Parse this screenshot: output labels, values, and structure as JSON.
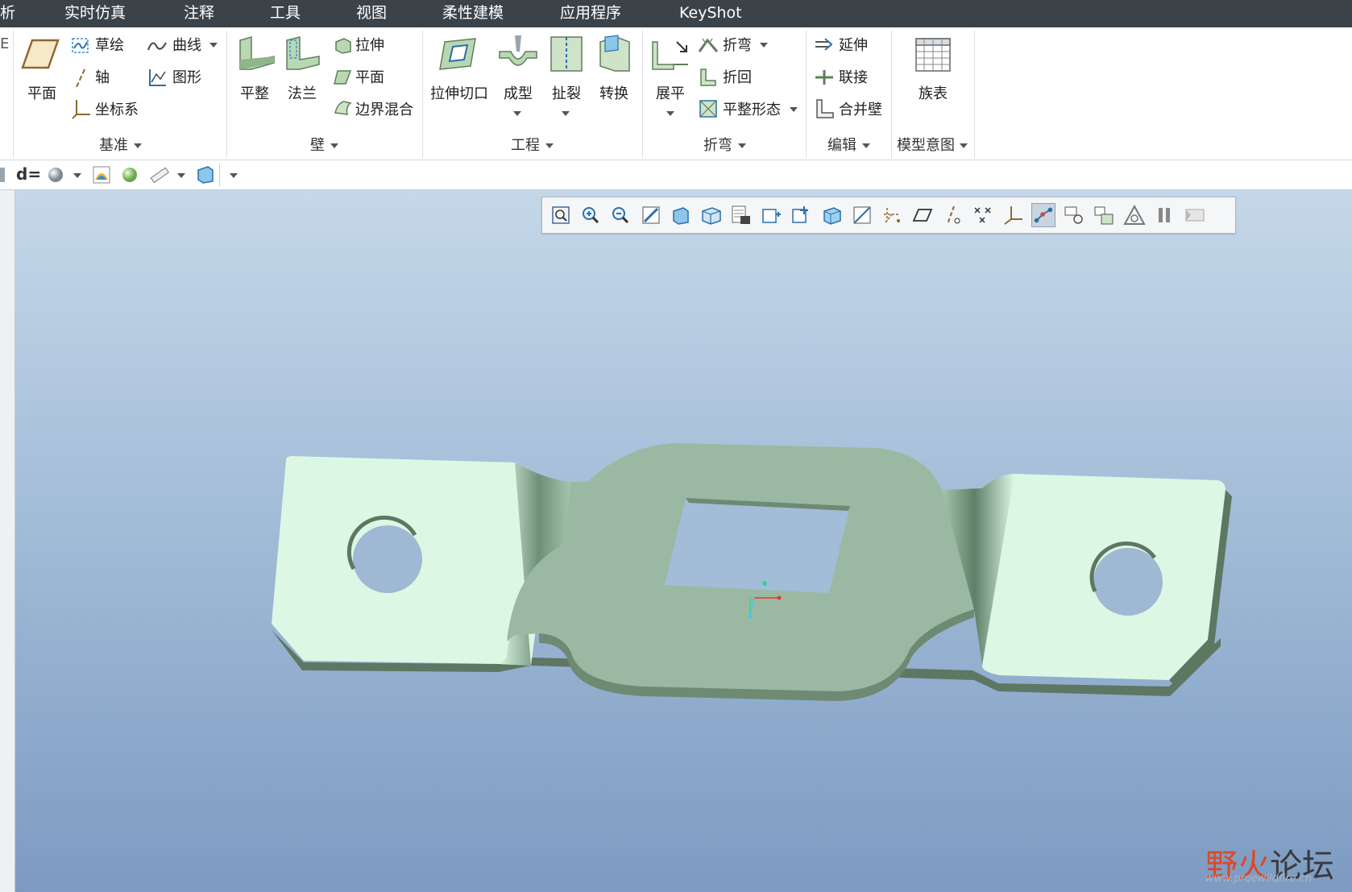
{
  "menu": {
    "partial_left": "析",
    "items": [
      "实时仿真",
      "注释",
      "工具",
      "视图",
      "柔性建模",
      "应用程序",
      "KeyShot"
    ]
  },
  "ribbon": {
    "partial_left": "E",
    "datum": {
      "plane": "平面",
      "sketch": "草绘",
      "curve": "曲线",
      "axis": "轴",
      "graph": "图形",
      "csys": "坐标系",
      "group": "基准"
    },
    "wall": {
      "flat": "平整",
      "flange": "法兰",
      "extrude": "拉伸",
      "planar": "平面",
      "boundary_blend": "边界混合",
      "group": "壁"
    },
    "engineering": {
      "extrude_cut": "拉伸切口",
      "form": "成型",
      "rip": "扯裂",
      "convert": "转换",
      "group": "工程"
    },
    "bends": {
      "unbend": "展平",
      "bend": "折弯",
      "bend_back": "折回",
      "flat_state": "平整形态",
      "group": "折弯"
    },
    "editing": {
      "extend": "延伸",
      "join": "联接",
      "merge_walls": "合并壁",
      "group": "编辑"
    },
    "model_intent": {
      "family_table": "族表",
      "group": "模型意图"
    }
  },
  "quickbar": {
    "d_label": "d="
  },
  "view_toolbar": {
    "icons": [
      "refit-icon",
      "zoom-in-icon",
      "zoom-out-icon",
      "repaint-icon",
      "shading-icon",
      "saved-views-icon",
      "view-manager-icon",
      "display-style-icon",
      "spin-center-icon",
      "perspective-icon",
      "section-icon",
      "datum-display-icon",
      "plane-display-icon",
      "axis-display-icon",
      "point-display-icon",
      "csys-display-icon",
      "annotation-display-icon",
      "appearance-icon",
      "view-orient-icon",
      "tolerance-icon",
      "pause-icon",
      "animation-icon"
    ],
    "active_index": 16
  },
  "watermark": {
    "text_a": "野",
    "text_b": "火",
    "text_c": "论坛",
    "url": "www.proewildfire.cn"
  },
  "colors": {
    "menubar": "#3b4349",
    "part_light": "#dcf7e4",
    "part_dark": "#9bb9a2",
    "bg_top": "#c5d8e9",
    "bg_bottom": "#7d9bc2"
  }
}
